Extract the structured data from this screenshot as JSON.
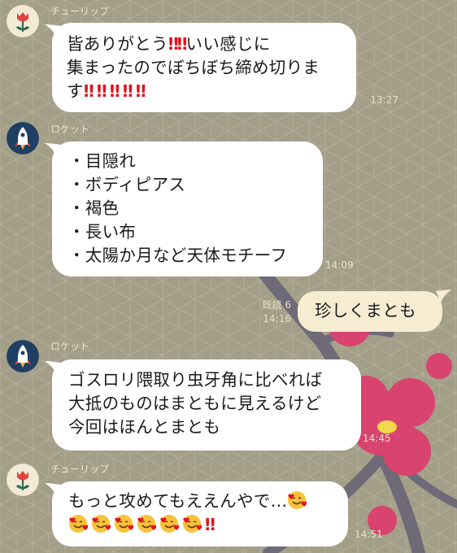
{
  "messages": [
    {
      "sender": "チューリップ",
      "avatar": "tulip-avatar",
      "lines": [
        "皆ありがとう‼️‼️いい感じに",
        "集まったのでぼちぼち締め切りま",
        "す‼️‼️‼️‼️‼️"
      ],
      "time": "13:27"
    },
    {
      "sender": "ロケット",
      "avatar": "rocket-avatar",
      "lines": [
        "・目隠れ",
        "・ボディピアス",
        "・褐色",
        "・長い布",
        "・太陽か月など天体モチーフ"
      ],
      "time": "14:09"
    },
    {
      "own": true,
      "text": "珍しくまとも",
      "read": "既読 6",
      "time": "14:16"
    },
    {
      "sender": "ロケット",
      "avatar": "rocket-avatar",
      "lines": [
        "ゴスロリ隈取り虫牙角に比べれば",
        "大抵のものはまともに見えるけど",
        "今回はほんとまとも"
      ],
      "time": "14:45"
    },
    {
      "sender": "チューリップ",
      "avatar": "tulip-avatar",
      "lines": [
        "もっと攻めてもええんやで…🥰",
        "🥰🥰🥰🥰🥰🥰‼️"
      ],
      "time": "14:51"
    }
  ],
  "colors": {
    "background": "#a39e88",
    "bubble": "#ffffff",
    "own_bubble": "#f5ecd2",
    "exclaim": "#e0141e",
    "branch": "#6f6a78",
    "blossom": "#d8446f"
  }
}
